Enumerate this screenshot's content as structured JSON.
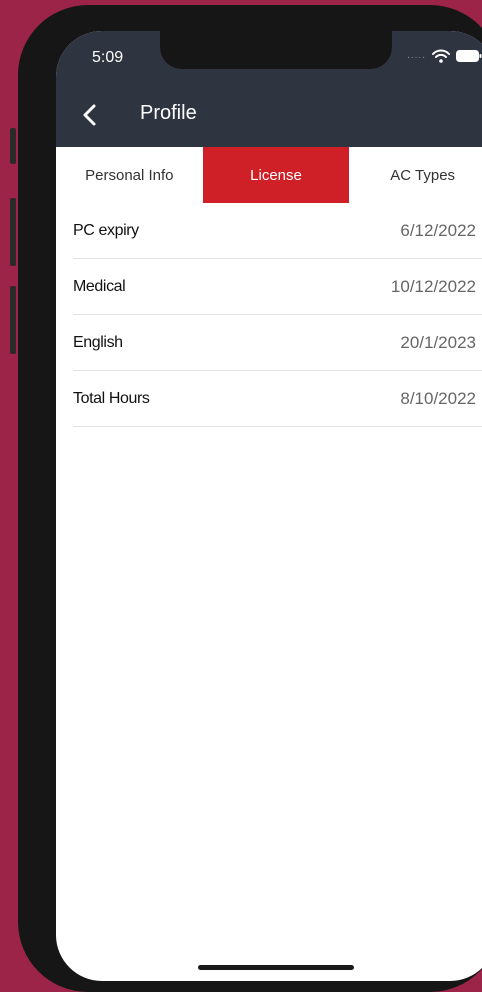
{
  "status_bar": {
    "time": "5:09",
    "signal": "....."
  },
  "header": {
    "title": "Profile"
  },
  "tabs": [
    {
      "label": "Personal Info",
      "active": false
    },
    {
      "label": "License",
      "active": true
    },
    {
      "label": "AC Types",
      "active": false
    }
  ],
  "rows": [
    {
      "label": "PC expiry",
      "value": "6/12/2022"
    },
    {
      "label": "Medical",
      "value": "10/12/2022"
    },
    {
      "label": "English",
      "value": "20/1/2023"
    },
    {
      "label": "Total Hours",
      "value": "8/10/2022"
    }
  ],
  "colors": {
    "background": "#9c2449",
    "header": "#2e3440",
    "active_tab": "#cf2027"
  },
  "icons": {
    "back": "chevron-left-icon",
    "wifi": "wifi-icon",
    "battery": "battery-icon"
  }
}
